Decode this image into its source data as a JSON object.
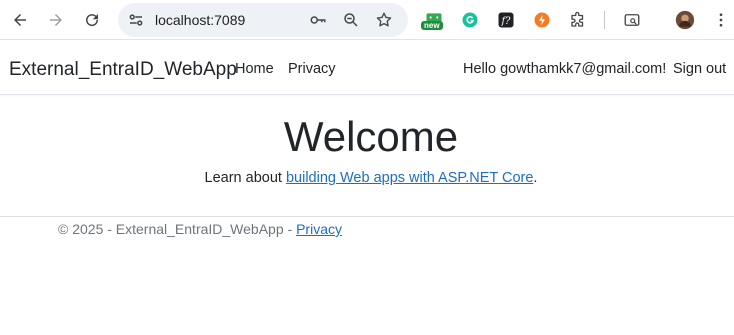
{
  "browser": {
    "url": "localhost:7089",
    "extensions": [
      "new-badge-extension",
      "grammarly",
      "formula-extension",
      "orange-extension",
      "extensions-puzzle"
    ],
    "new_badge": "new"
  },
  "app": {
    "brand": "External_EntraID_WebApp",
    "nav": {
      "home": "Home",
      "privacy": "Privacy"
    },
    "hello": "Hello gowthamkk7@gmail.com!",
    "signout": "Sign out"
  },
  "main": {
    "title": "Welcome",
    "learn_prefix": "Learn about ",
    "learn_link": "building Web apps with ASP.NET Core",
    "learn_suffix": "."
  },
  "footer": {
    "text": "© 2025 - External_EntraID_WebApp - ",
    "privacy": "Privacy"
  },
  "colors": {
    "link": "#1b6ec2",
    "omnibox_bg": "#eef1f6"
  }
}
